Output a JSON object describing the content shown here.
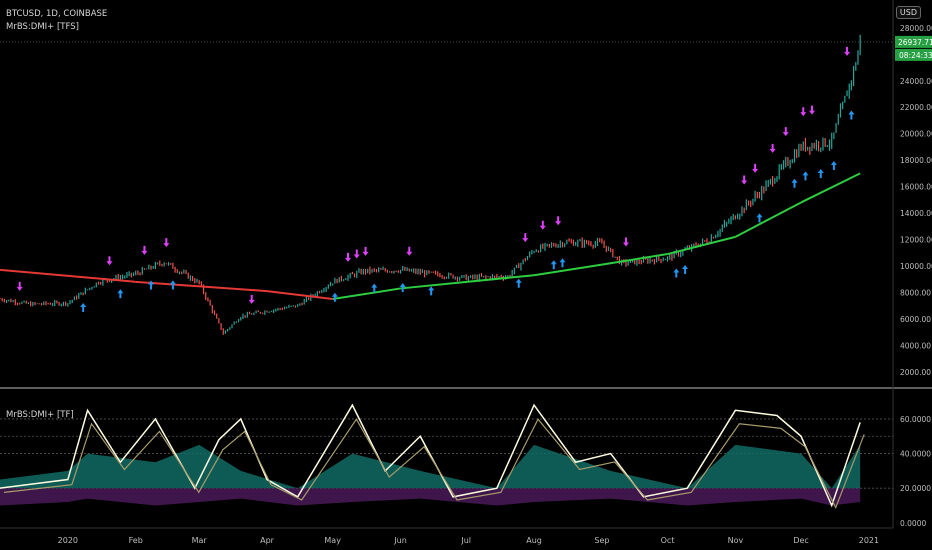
{
  "header": {
    "symbol_line": "BTCUSD, 1D, COINBASE",
    "indicator_line": "MrBS:DMI+ [TFS]",
    "currency_button": "USD"
  },
  "lower_pane": {
    "indicator_label": "MrBS:DMI+ [TF]"
  },
  "price_badges": {
    "last_price": "26937.71",
    "countdown": "08:24:33",
    "badge_color": "#26a042"
  },
  "colors": {
    "bull_bar": "#26a69a",
    "bear_bar": "#ef5350",
    "buy_arrow": "#2196f3",
    "sell_arrow": "#e040fb",
    "ma_up": "#2ecc40",
    "ma_down": "#e53935",
    "adx_line": "#fffde0",
    "dmi_line": "#a79b6a",
    "fill_up": "#0f6b63",
    "fill_down": "#5a1f6b"
  },
  "chart_data": [
    {
      "type": "line",
      "name": "price",
      "x_ticks": [
        "2020",
        "Feb",
        "Mar",
        "Apr",
        "May",
        "Jun",
        "Jul",
        "Aug",
        "Sep",
        "Oct",
        "Nov",
        "Dec",
        "2021"
      ],
      "y_ticks": [
        "2000.00",
        "4000.00",
        "6000.00",
        "8000.00",
        "10000.00",
        "12000.00",
        "14000.00",
        "16000.00",
        "18000.00",
        "20000.00",
        "22000.00",
        "24000.00",
        "26000.00",
        "28000.00"
      ],
      "ylim": [
        1000,
        29500
      ],
      "price_path": [
        {
          "x": "2019-12-01",
          "y": 7500
        },
        {
          "x": "2019-12-15",
          "y": 7100
        },
        {
          "x": "2020-01-01",
          "y": 7200
        },
        {
          "x": "2020-01-15",
          "y": 8800
        },
        {
          "x": "2020-02-01",
          "y": 9400
        },
        {
          "x": "2020-02-14",
          "y": 10300
        },
        {
          "x": "2020-03-01",
          "y": 8700
        },
        {
          "x": "2020-03-12",
          "y": 4900
        },
        {
          "x": "2020-03-20",
          "y": 6200
        },
        {
          "x": "2020-04-01",
          "y": 6600
        },
        {
          "x": "2020-04-15",
          "y": 7000
        },
        {
          "x": "2020-05-01",
          "y": 8800
        },
        {
          "x": "2020-05-15",
          "y": 9600
        },
        {
          "x": "2020-06-01",
          "y": 9700
        },
        {
          "x": "2020-06-15",
          "y": 9400
        },
        {
          "x": "2020-07-01",
          "y": 9100
        },
        {
          "x": "2020-07-20",
          "y": 9200
        },
        {
          "x": "2020-08-01",
          "y": 11200
        },
        {
          "x": "2020-08-15",
          "y": 11800
        },
        {
          "x": "2020-09-01",
          "y": 11700
        },
        {
          "x": "2020-09-10",
          "y": 10200
        },
        {
          "x": "2020-10-01",
          "y": 10600
        },
        {
          "x": "2020-10-20",
          "y": 12000
        },
        {
          "x": "2020-11-01",
          "y": 13800
        },
        {
          "x": "2020-11-15",
          "y": 16000
        },
        {
          "x": "2020-12-01",
          "y": 19000
        },
        {
          "x": "2020-12-15",
          "y": 19400
        },
        {
          "x": "2020-12-25",
          "y": 24700
        },
        {
          "x": "2020-12-28",
          "y": 26900
        }
      ],
      "moving_average": [
        {
          "x": "2019-12-01",
          "y": 9700
        },
        {
          "x": "2020-02-01",
          "y": 8800
        },
        {
          "x": "2020-04-01",
          "y": 8100
        },
        {
          "x": "2020-05-01",
          "y": 7500
        },
        {
          "x": "2020-06-01",
          "y": 8300
        },
        {
          "x": "2020-08-01",
          "y": 9300
        },
        {
          "x": "2020-09-01",
          "y": 10100
        },
        {
          "x": "2020-10-01",
          "y": 10900
        },
        {
          "x": "2020-11-01",
          "y": 12200
        },
        {
          "x": "2020-12-01",
          "y": 14800
        },
        {
          "x": "2020-12-28",
          "y": 17000
        }
      ]
    },
    {
      "type": "line",
      "name": "MrBS:DMI+ [TF]",
      "y_ticks": [
        "0.0000",
        "20.0000",
        "40.0000",
        "60.0000"
      ],
      "ylim": [
        -3,
        75
      ],
      "reference_lines": [
        20,
        40,
        50,
        60
      ],
      "adx": [
        {
          "x": "2019-12-01",
          "y": 20
        },
        {
          "x": "2020-01-01",
          "y": 25
        },
        {
          "x": "2020-01-10",
          "y": 65
        },
        {
          "x": "2020-01-25",
          "y": 35
        },
        {
          "x": "2020-02-10",
          "y": 60
        },
        {
          "x": "2020-02-28",
          "y": 20
        },
        {
          "x": "2020-03-10",
          "y": 48
        },
        {
          "x": "2020-03-20",
          "y": 60
        },
        {
          "x": "2020-04-01",
          "y": 25
        },
        {
          "x": "2020-04-15",
          "y": 15
        },
        {
          "x": "2020-05-10",
          "y": 68
        },
        {
          "x": "2020-05-25",
          "y": 30
        },
        {
          "x": "2020-06-10",
          "y": 50
        },
        {
          "x": "2020-06-25",
          "y": 15
        },
        {
          "x": "2020-07-15",
          "y": 20
        },
        {
          "x": "2020-08-01",
          "y": 68
        },
        {
          "x": "2020-08-20",
          "y": 35
        },
        {
          "x": "2020-09-05",
          "y": 40
        },
        {
          "x": "2020-09-20",
          "y": 15
        },
        {
          "x": "2020-10-10",
          "y": 20
        },
        {
          "x": "2020-11-01",
          "y": 65
        },
        {
          "x": "2020-11-20",
          "y": 62
        },
        {
          "x": "2020-12-01",
          "y": 50
        },
        {
          "x": "2020-12-15",
          "y": 10
        },
        {
          "x": "2020-12-28",
          "y": 58
        }
      ],
      "dmi_filled": [
        {
          "x": "2019-12-01",
          "y": 25
        },
        {
          "x": "2020-01-01",
          "y": 30
        },
        {
          "x": "2020-01-10",
          "y": 40
        },
        {
          "x": "2020-02-10",
          "y": 35
        },
        {
          "x": "2020-03-01",
          "y": 45
        },
        {
          "x": "2020-03-20",
          "y": 30
        },
        {
          "x": "2020-04-15",
          "y": 20
        },
        {
          "x": "2020-05-10",
          "y": 40
        },
        {
          "x": "2020-06-10",
          "y": 30
        },
        {
          "x": "2020-07-15",
          "y": 20
        },
        {
          "x": "2020-08-01",
          "y": 45
        },
        {
          "x": "2020-09-05",
          "y": 30
        },
        {
          "x": "2020-10-10",
          "y": 20
        },
        {
          "x": "2020-11-01",
          "y": 45
        },
        {
          "x": "2020-12-01",
          "y": 40
        },
        {
          "x": "2020-12-15",
          "y": 20
        },
        {
          "x": "2020-12-28",
          "y": 45
        }
      ]
    }
  ]
}
